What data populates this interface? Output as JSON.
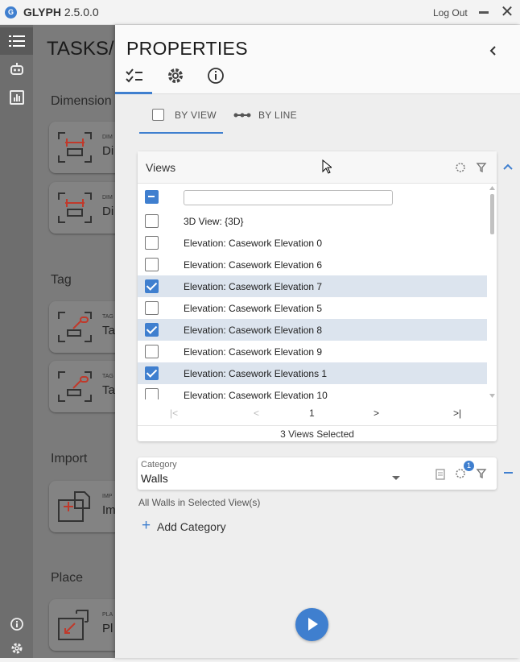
{
  "window": {
    "logo_letter": "G",
    "app_name": "GLYPH",
    "version": "2.5.0.0",
    "logout_label": "Log Out",
    "close_glyph": "✕"
  },
  "rail": {
    "items": [
      "list-icon",
      "robot-icon",
      "chart-icon"
    ],
    "bottom": [
      "info-icon",
      "gear-icon"
    ]
  },
  "background": {
    "title": "TASKS/E",
    "sections": [
      {
        "label": "Dimension",
        "cards": [
          {
            "small": "DIM",
            "label": "Di"
          },
          {
            "small": "DIM",
            "label": "Di"
          }
        ]
      },
      {
        "label": "Tag",
        "cards": [
          {
            "small": "TAG",
            "label": "Ta"
          },
          {
            "small": "TAG",
            "label": "Ta"
          }
        ]
      },
      {
        "label": "Import",
        "cards": [
          {
            "small": "IMP",
            "label": "Im"
          }
        ]
      },
      {
        "label": "Place",
        "cards": [
          {
            "small": "PLA",
            "label": "Pl"
          }
        ]
      }
    ]
  },
  "panel": {
    "title": "PROPERTIES",
    "tabs": [
      "checklist-icon",
      "gear-icon",
      "info-icon"
    ],
    "subtabs": [
      {
        "label": "BY VIEW",
        "active": true
      },
      {
        "label": "BY LINE",
        "active": false
      }
    ]
  },
  "views": {
    "title": "Views",
    "filter_value": "",
    "rows": [
      {
        "label": "3D View: {3D}",
        "checked": false
      },
      {
        "label": "Elevation: Casework Elevation 0",
        "checked": false
      },
      {
        "label": "Elevation: Casework Elevation 6",
        "checked": false
      },
      {
        "label": "Elevation: Casework Elevation 7",
        "checked": true
      },
      {
        "label": "Elevation: Casework Elevation 5",
        "checked": false
      },
      {
        "label": "Elevation: Casework Elevation 8",
        "checked": true
      },
      {
        "label": "Elevation: Casework Elevation 9",
        "checked": false
      },
      {
        "label": "Elevation: Casework Elevations 1",
        "checked": true
      },
      {
        "label": "Elevation: Casework Elevation 10",
        "checked": false
      }
    ],
    "pager": {
      "first": "|<",
      "prev": "<",
      "page": "1",
      "next": ">",
      "last": ">|"
    },
    "selected_text": "3 Views Selected"
  },
  "category": {
    "label": "Category",
    "value": "Walls",
    "badge": "1",
    "description": "All Walls in Selected View(s)",
    "add_label": "Add Category",
    "add_glyph": "+"
  },
  "colors": {
    "accent": "#3f7fcf",
    "selected_row": "#dce4ee",
    "rail": "#6e6e6e"
  }
}
